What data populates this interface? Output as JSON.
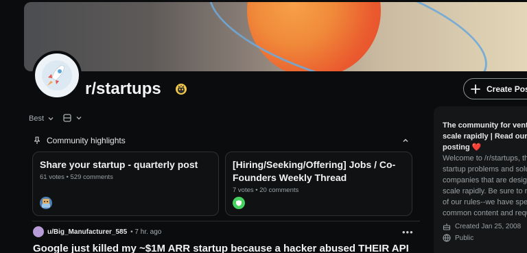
{
  "community": {
    "name": "r/startups"
  },
  "header": {
    "create_post_label": "Create Post"
  },
  "feed": {
    "sort_label": "Best"
  },
  "highlights": {
    "title": "Community highlights",
    "cards": [
      {
        "title": "Share your startup - quarterly post",
        "meta": "61 votes • 529 comments"
      },
      {
        "title": "[Hiring/Seeking/Offering] Jobs / Co-Founders Weekly Thread",
        "meta": "7 votes • 20 comments"
      }
    ]
  },
  "post": {
    "author": "u/Big_Manufacturer_585",
    "time": "• 7 hr. ago",
    "more_label": "•••",
    "title": "Google just killed my ~$1M ARR startup because a hacker abused THEIR API"
  },
  "sidebar": {
    "heading_line1": "The community for vent",
    "heading_line2": "scale rapidly | Read our",
    "heading_line3": "posting",
    "heart": "❤️",
    "desc_lines": [
      "Welcome to /r/startups, th",
      "startup problems and solu",
      "companies that are desig",
      "scale rapidly. Be sure to r",
      "of our rules--we have spe",
      "common content and requ"
    ],
    "created": "Created Jan 25, 2008",
    "visibility": "Public"
  },
  "colors": {
    "background": "#0b0c0d",
    "card_border": "#2e3235",
    "accent_heart": "#e74c3c"
  },
  "icons": {
    "banner": "planet-banner",
    "avatar": "rocket-icon",
    "mod": "mod-shield-icon",
    "create": "plus-icon",
    "sort_chevron": "chevron-down-icon",
    "view": "layout-icon",
    "pin": "pin-icon",
    "collapse": "chevron-up-icon",
    "created": "cake-icon",
    "public": "globe-icon"
  }
}
